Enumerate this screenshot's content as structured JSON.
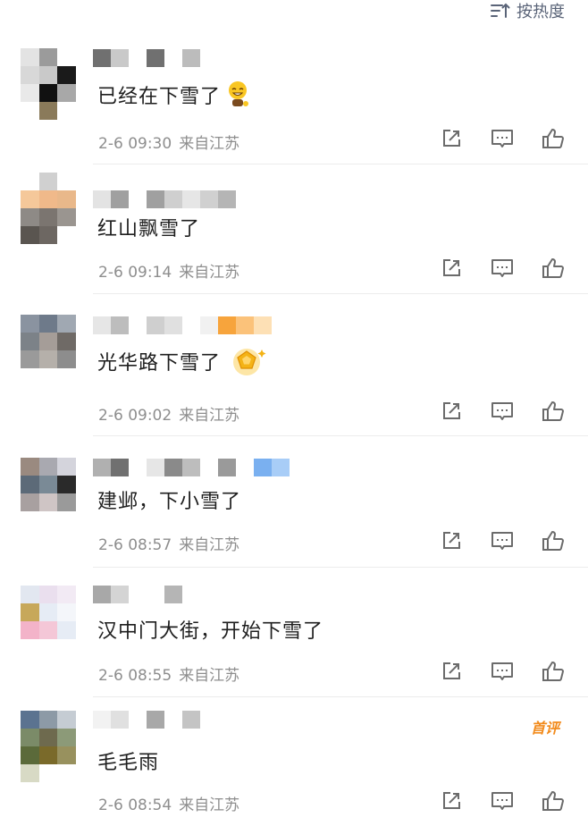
{
  "sort": {
    "label": "按热度"
  },
  "comments": [
    {
      "text": "已经在下雪了",
      "date": "2-6",
      "time": "09:30",
      "location": "来自江苏"
    },
    {
      "text": "红山飘雪了",
      "date": "2-6",
      "time": "09:14",
      "location": "来自江苏"
    },
    {
      "text": "光华路下雪了",
      "date": "2-6",
      "time": "09:02",
      "location": "来自江苏"
    },
    {
      "text": "建邺，下小雪了",
      "date": "2-6",
      "time": "08:57",
      "location": "来自江苏"
    },
    {
      "text": "汉中门大街，开始下雪了",
      "date": "2-6",
      "time": "08:55",
      "location": "来自江苏"
    },
    {
      "text": "毛毛雨",
      "date": "2-6",
      "time": "08:54",
      "location": "来自江苏",
      "badge": "首评"
    }
  ],
  "colors": {
    "meta": "#8e8e8e",
    "icon": "#6b6b6b",
    "badge": "#f28b1c"
  },
  "icons": [
    "sort-icon",
    "share-icon",
    "comment-icon",
    "like-icon",
    "grin-emoji-icon",
    "medal-emoji-icon"
  ]
}
